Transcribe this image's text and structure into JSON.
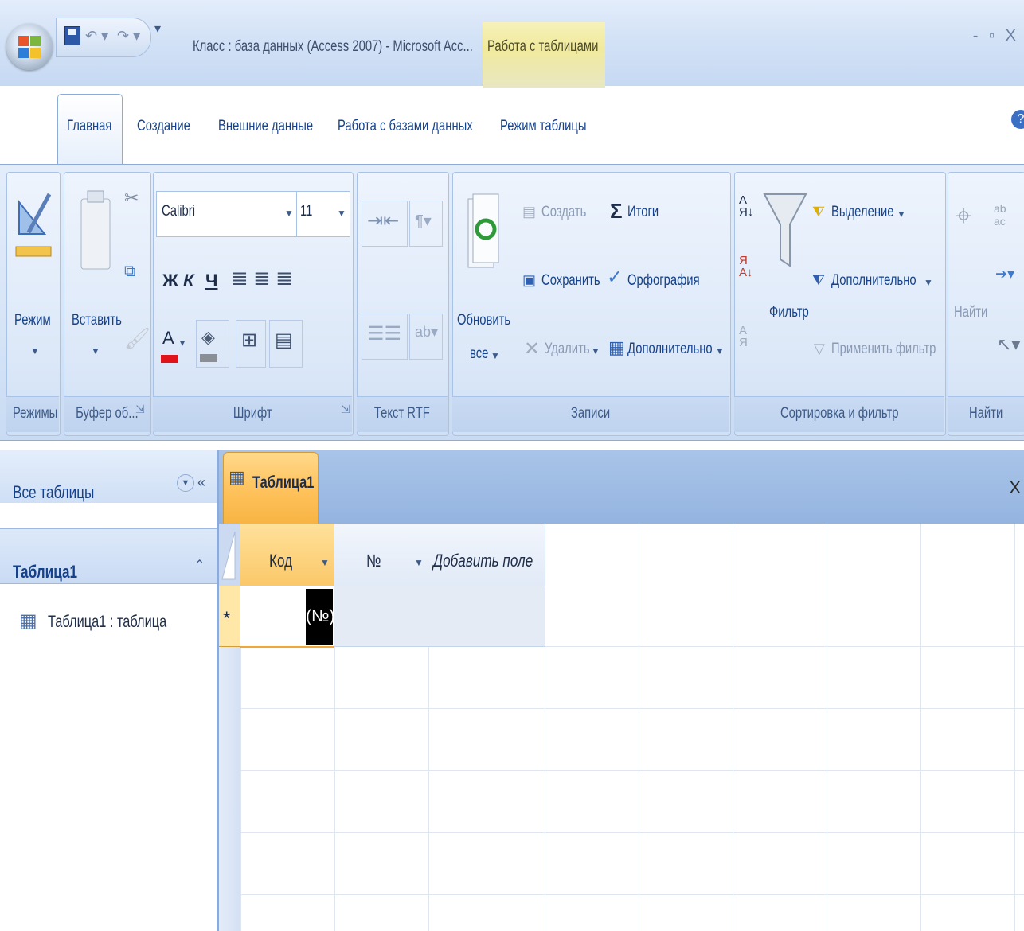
{
  "window": {
    "title": "Класс : база данных (Access 2007) - Microsoft Acc...",
    "context_header": "Работа с таблицами",
    "controls": "- ▫ X"
  },
  "tabs": [
    "Главная",
    "Создание",
    "Внешние данные",
    "Работа с базами данных",
    "Режим таблицы"
  ],
  "ribbon": {
    "views": {
      "button": "Режим",
      "group": "Режимы"
    },
    "clipboard": {
      "button": "Вставить",
      "group": "Буфер об..."
    },
    "font": {
      "name": "Calibri",
      "size": "11",
      "bold": "Ж",
      "italic": "К",
      "underline": "Ч",
      "color_letter": "A",
      "group": "Шрифт"
    },
    "rtf": {
      "group": "Текст RTF"
    },
    "records": {
      "refresh_line1": "Обновить",
      "refresh_line2": "все",
      "new": "Создать",
      "save": "Сохранить",
      "delete": "Удалить",
      "totals": "Итоги",
      "spelling": "Орфография",
      "more": "Дополнительно",
      "group": "Записи"
    },
    "sort_filter": {
      "filter": "Фильтр",
      "selection": "Выделение",
      "advanced": "Дополнительно",
      "apply": "Применить фильтр",
      "group": "Сортировка и фильтр"
    },
    "find": {
      "button": "Найти",
      "group": "Найти"
    }
  },
  "nav": {
    "header": "Все таблицы",
    "group": "Таблица1",
    "items": [
      "Таблица1 : таблица"
    ]
  },
  "document": {
    "tab": "Таблица1",
    "close": "X",
    "columns": [
      "Код",
      "№",
      "Добавить поле"
    ],
    "new_row_marker": "*",
    "new_row_value": "(№)"
  },
  "colors": {
    "ribbon": "#dce8f8",
    "accent_text": "#15428b",
    "selected_tab": "#ffc15a",
    "context_tab": "#f1ea9d"
  }
}
